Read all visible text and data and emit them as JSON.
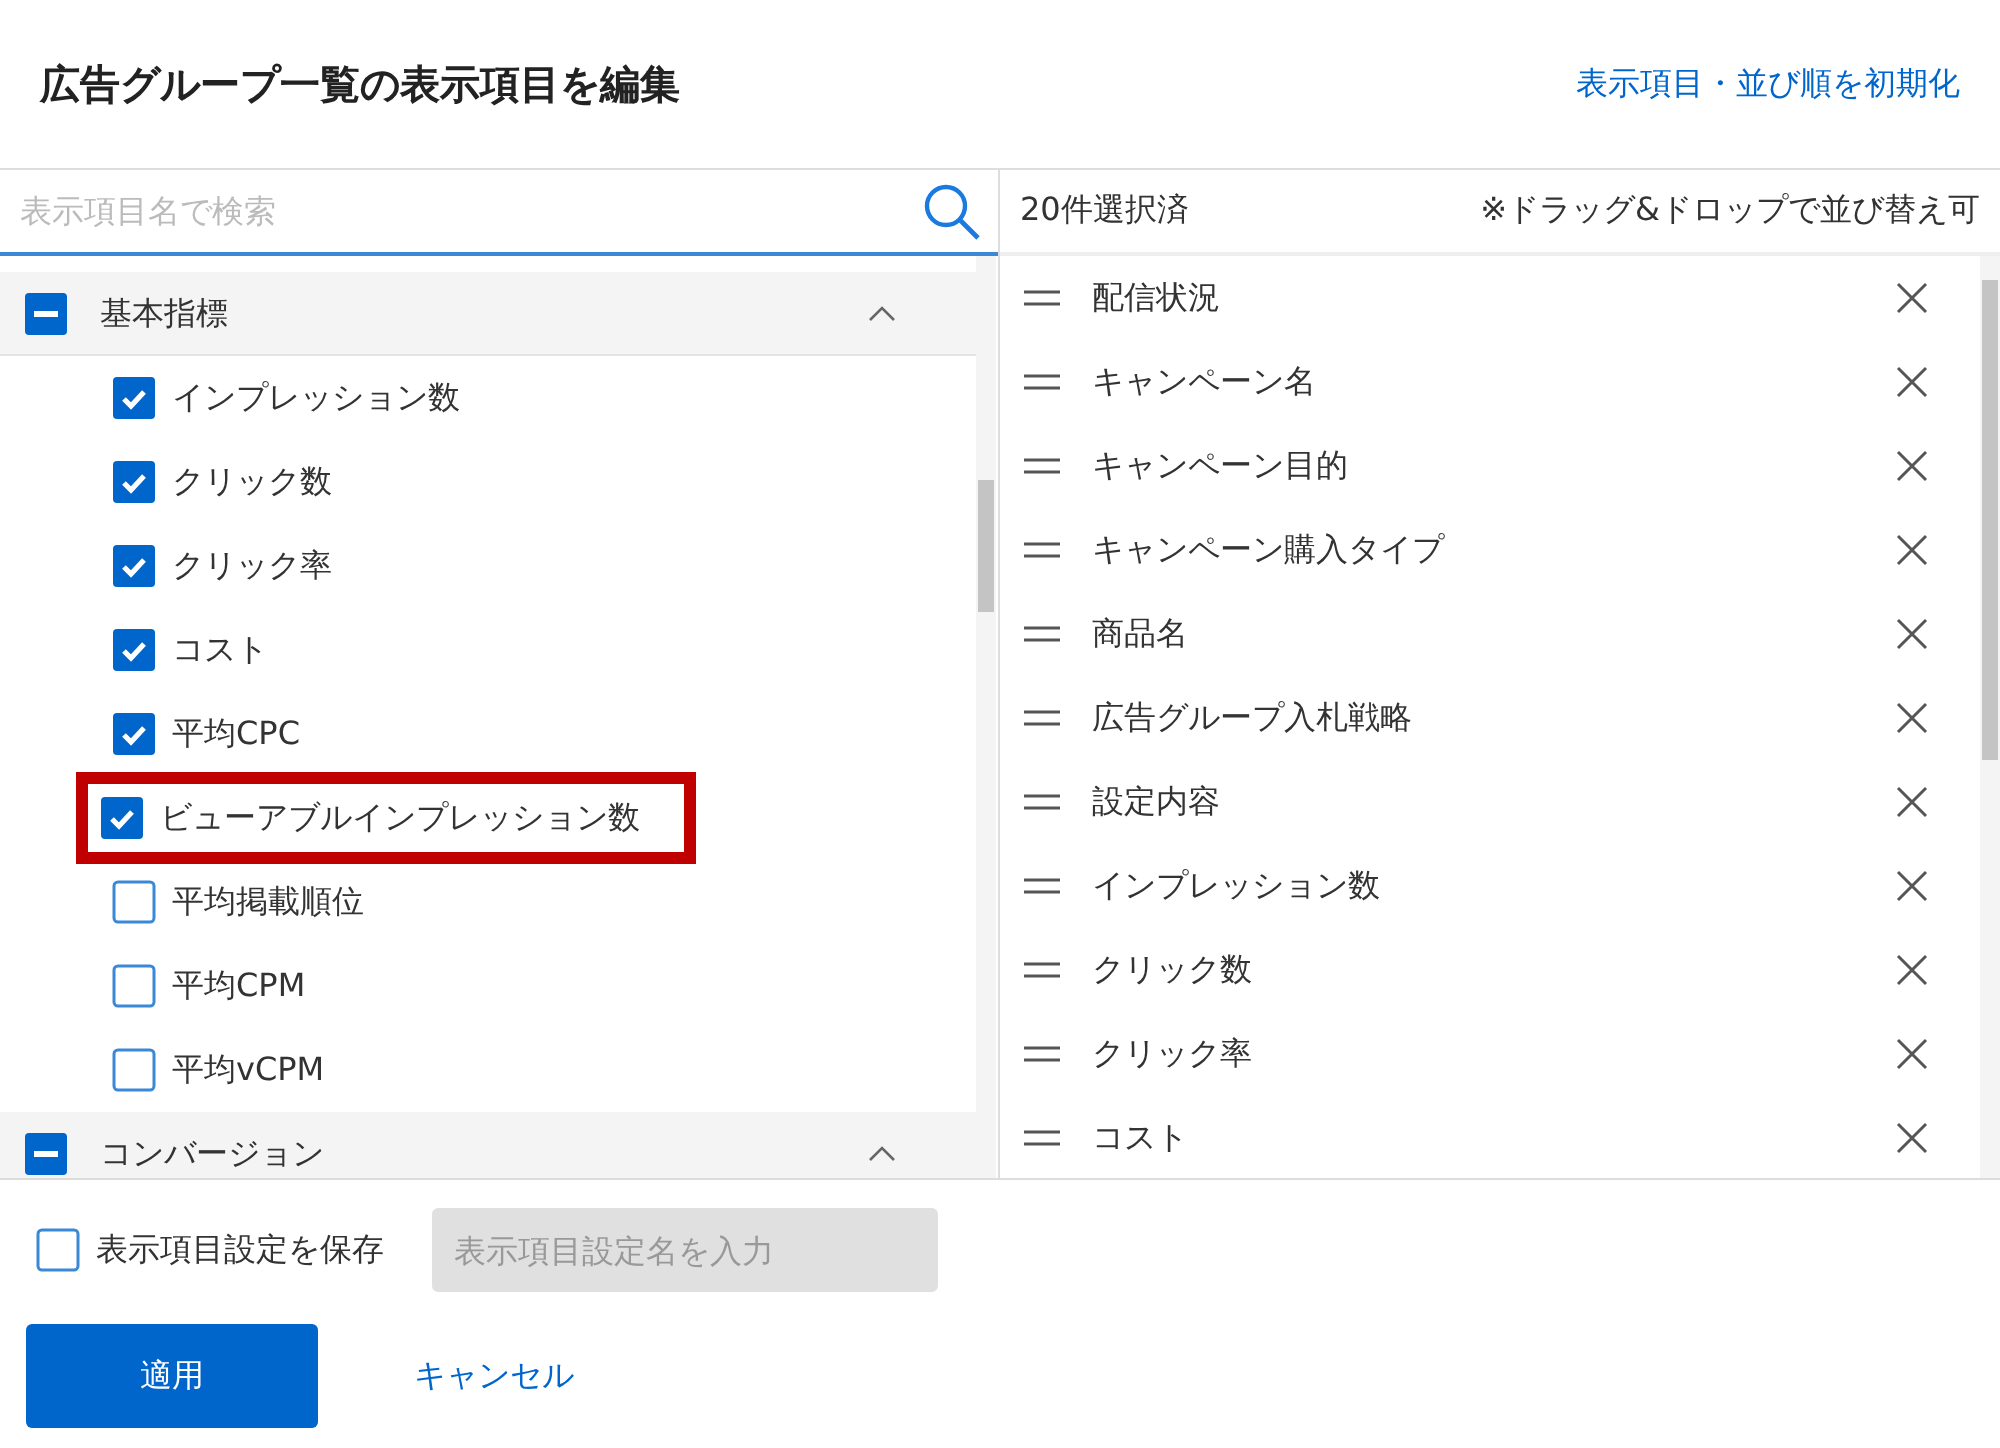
{
  "dialog": {
    "title": "広告グループ一覧の表示項目を編集",
    "reset_link": "表示項目・並び順を初期化"
  },
  "search": {
    "placeholder": "表示項目名で検索"
  },
  "groups": [
    {
      "label": "基本指標",
      "indeterminate": true,
      "expanded": true,
      "items": [
        {
          "label": "インプレッション数",
          "checked": true,
          "highlighted": false
        },
        {
          "label": "クリック数",
          "checked": true,
          "highlighted": false
        },
        {
          "label": "クリック率",
          "checked": true,
          "highlighted": false
        },
        {
          "label": "コスト",
          "checked": true,
          "highlighted": false
        },
        {
          "label": "平均CPC",
          "checked": true,
          "highlighted": false
        },
        {
          "label": "ビューアブルインプレッション数",
          "checked": true,
          "highlighted": true
        },
        {
          "label": "平均掲載順位",
          "checked": false,
          "highlighted": false
        },
        {
          "label": "平均CPM",
          "checked": false,
          "highlighted": false
        },
        {
          "label": "平均vCPM",
          "checked": false,
          "highlighted": false
        }
      ]
    },
    {
      "label": "コンバージョン",
      "indeterminate": true,
      "expanded": true
    }
  ],
  "selected_panel": {
    "count": "20件選択済",
    "hint": "※ドラッグ&ドロップで並び替え可",
    "items": [
      "配信状況",
      "キャンペーン名",
      "キャンペーン目的",
      "キャンペーン購入タイプ",
      "商品名",
      "広告グループ入札戦略",
      "設定内容",
      "インプレッション数",
      "クリック数",
      "クリック率",
      "コスト"
    ]
  },
  "footer": {
    "save_checkbox": {
      "label": "表示項目設定を保存",
      "checked": false
    },
    "name_field": {
      "placeholder": "表示項目設定名を入力",
      "disabled": true
    },
    "apply_button": "適用",
    "cancel_link": "キャンセル"
  }
}
